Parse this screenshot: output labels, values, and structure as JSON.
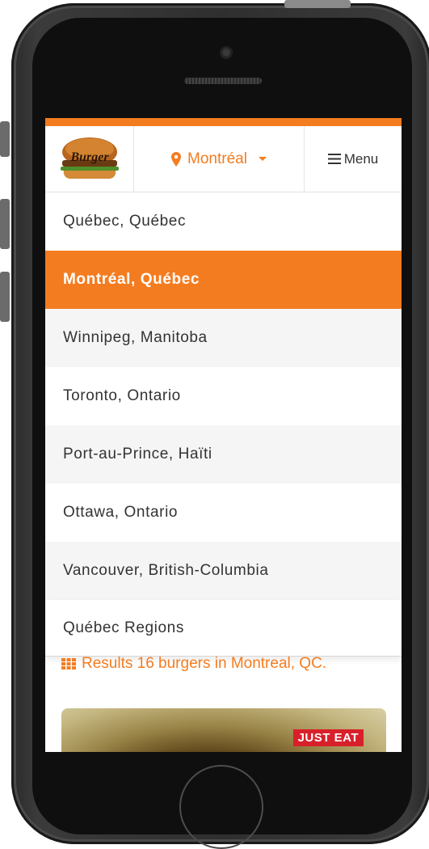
{
  "header": {
    "logo_alt": "Burger Week",
    "city_label": "Montréal",
    "menu_label": "Menu"
  },
  "dropdown": {
    "items": [
      {
        "label": "Québec, Québec"
      },
      {
        "label": "Montréal, Québec",
        "selected": true
      },
      {
        "label": "Winnipeg, Manitoba"
      },
      {
        "label": "Toronto, Ontario"
      },
      {
        "label": "Port-au-Prince, Haïti"
      },
      {
        "label": "Ottawa, Ontario"
      },
      {
        "label": "Vancouver, British-Columbia"
      },
      {
        "label": "Québec Regions"
      }
    ]
  },
  "results": {
    "text": "Results 16 burgers in Montreal, QC."
  },
  "card": {
    "badge": "JUST EAT"
  },
  "colors": {
    "accent": "#f47c20",
    "badge": "#d8202a"
  }
}
